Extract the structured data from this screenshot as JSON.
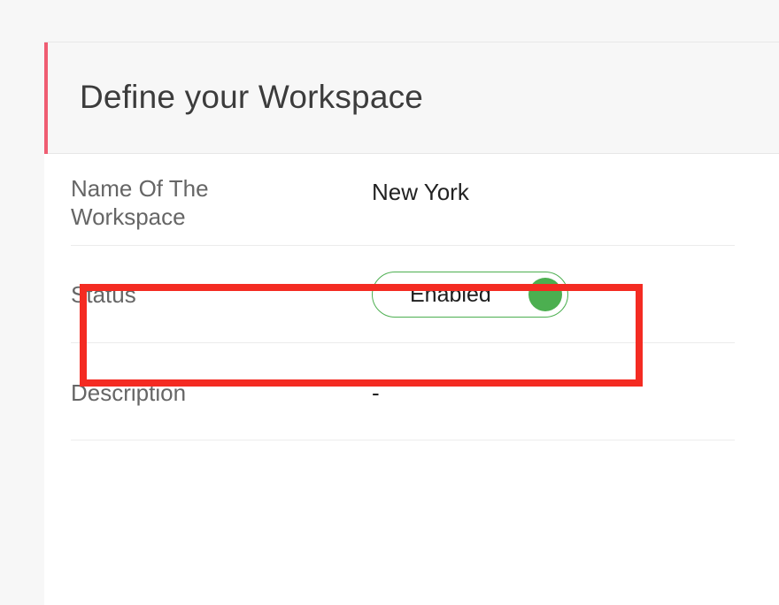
{
  "header": {
    "title": "Define your Workspace",
    "accent_color": "#ef5d72"
  },
  "fields": {
    "name": {
      "label": "Name Of The Workspace",
      "value": "New York"
    },
    "status": {
      "label": "Status",
      "toggle_label": "Enabled",
      "enabled": true,
      "toggle_color": "#4caf50"
    },
    "description": {
      "label": "Description",
      "value": "-"
    }
  },
  "annotation": {
    "highlight_color": "#f42b22"
  }
}
